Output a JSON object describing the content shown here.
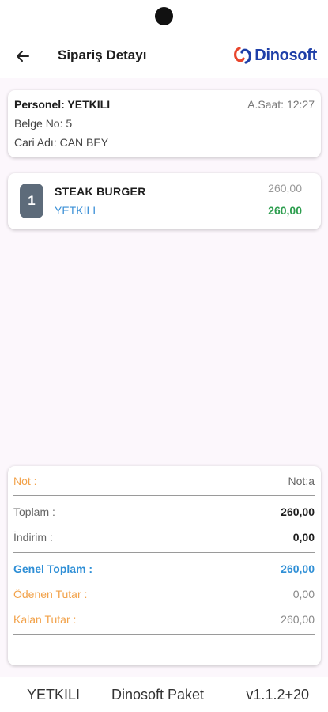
{
  "header": {
    "back_icon": "arrow-left-icon",
    "title": "Sipariş Detayı",
    "logo": {
      "text": "Dinosoft",
      "icon": "dinosoft-logo-icon",
      "color": "#1e3fa8",
      "accent": "#e8452c"
    }
  },
  "order": {
    "personel": "Personel: YETKILI",
    "time": "A.Saat: 12:27",
    "belge": "Belge No: 5",
    "cari": "Cari Adı: CAN BEY"
  },
  "items": [
    {
      "qty": "1",
      "name": "STEAK BURGER",
      "user": "YETKILI",
      "price": "260,00",
      "total": "260,00"
    }
  ],
  "summary": {
    "not_label": "Not :",
    "not_value": "Not:a",
    "toplam_label": "Toplam :",
    "toplam_value": "260,00",
    "indirim_label": "İndirim :",
    "indirim_value": "0,00",
    "genel_label": "Genel Toplam :",
    "genel_value": "260,00",
    "odenen_label": "Ödenen Tutar :",
    "odenen_value": "0,00",
    "kalan_label": "Kalan Tutar :",
    "kalan_value": "260,00"
  },
  "footer": {
    "user": "YETKILI",
    "app": "Dinosoft Paket",
    "version": "v1.1.2+20"
  },
  "colors": {
    "green": "#2e9e4f",
    "blue": "#2f8fd6",
    "orange": "#f2a24a",
    "badge": "#5d6b7a"
  }
}
